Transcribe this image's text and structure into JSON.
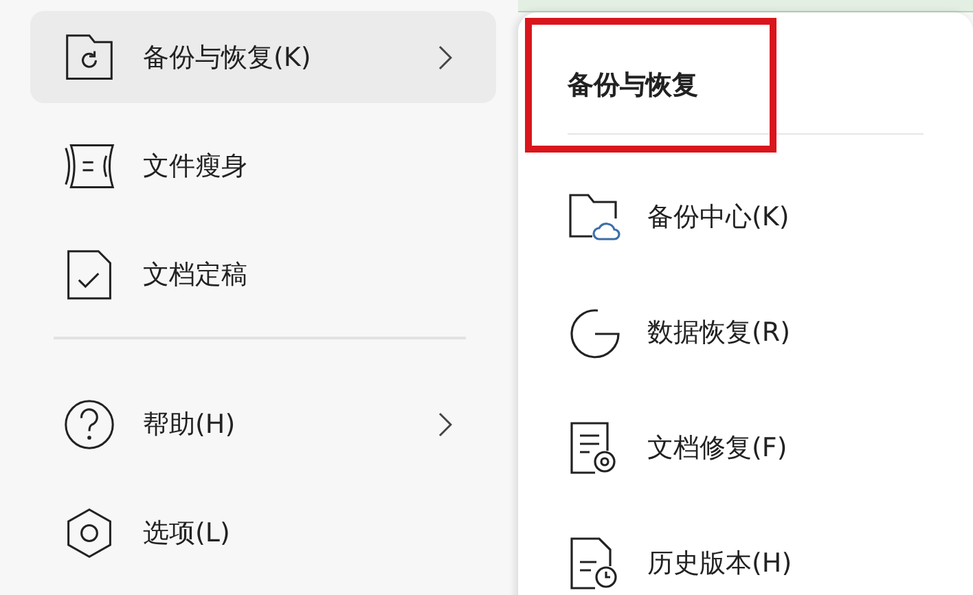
{
  "main_menu": {
    "items": [
      {
        "label": "备份与恢复(K)",
        "kind": "backup",
        "has_submenu": true,
        "selected": true
      },
      {
        "label": "文件瘦身",
        "kind": "slim",
        "has_submenu": false,
        "selected": false
      },
      {
        "label": "文档定稿",
        "kind": "finalize",
        "has_submenu": false,
        "selected": false
      },
      {
        "kind": "divider"
      },
      {
        "label": "帮助(H)",
        "kind": "help",
        "has_submenu": true,
        "selected": false
      },
      {
        "label": "选项(L)",
        "kind": "options",
        "has_submenu": false,
        "selected": false
      }
    ]
  },
  "submenu": {
    "title": "备份与恢复",
    "title_highlighted": true,
    "items": [
      {
        "label": "备份中心(K)",
        "kind": "cloud-folder"
      },
      {
        "label": "数据恢复(R)",
        "kind": "restore"
      },
      {
        "label": "文档修复(F)",
        "kind": "repair"
      },
      {
        "label": "历史版本(H)",
        "kind": "history"
      }
    ]
  }
}
